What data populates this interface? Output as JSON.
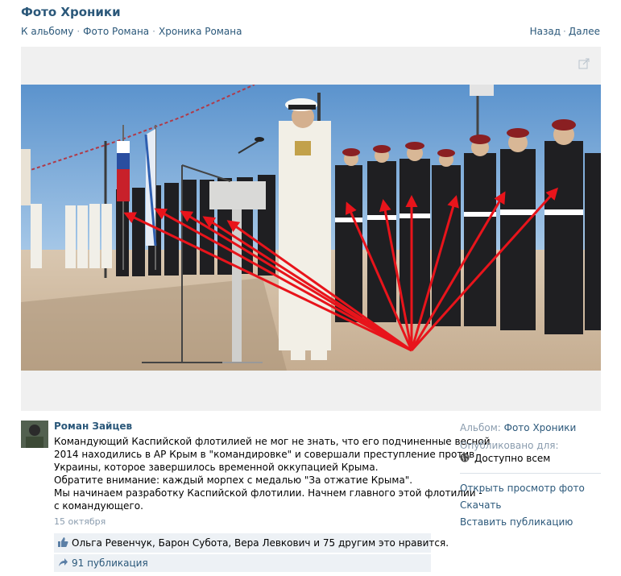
{
  "header": {
    "title": "Фото Хроники",
    "breadcrumbs": [
      "К альбому",
      "Фото Романа",
      "Хроника Романа"
    ],
    "separator": "·",
    "nav_back": "Назад",
    "nav_next": "Далее"
  },
  "post": {
    "author": "Роман Зайцев",
    "description_lines": [
      "Командующий Каспийской флотилией не мог не знать, что его подчиненные весной",
      "2014 находились в АР Крым в \"командировке\" и совершали преступление против",
      "Украины, которое завершилось временной оккупацией Крыма.",
      "Обратите внимание: каждый морпех с медалью \"За отжатие Крыма\".",
      "Мы начинаем разработку Каспийской флотилии. Начнем главного этой флотилии -",
      "с командующего."
    ],
    "date": "15 октября",
    "likes_text": "Ольга Ревенчук, Барон Субота, Вера Левкович и 75 другим это нравится.",
    "shares_text": "91 публикация"
  },
  "sidebar": {
    "album_label": "Альбом:",
    "album_name": "Фото Хроники",
    "published_label": "Опубликовано для:",
    "privacy": "Доступно всем",
    "actions": [
      "Открыть просмотр фото",
      "Скачать",
      "Вставить публикацию"
    ]
  },
  "colors": {
    "link": "#2b587a",
    "muted": "#8a9cae",
    "panel": "#edf1f5",
    "arrow": "#e8141b"
  },
  "icons": [
    "expand-icon",
    "like-thumb-icon",
    "share-icon",
    "globe-icon"
  ]
}
